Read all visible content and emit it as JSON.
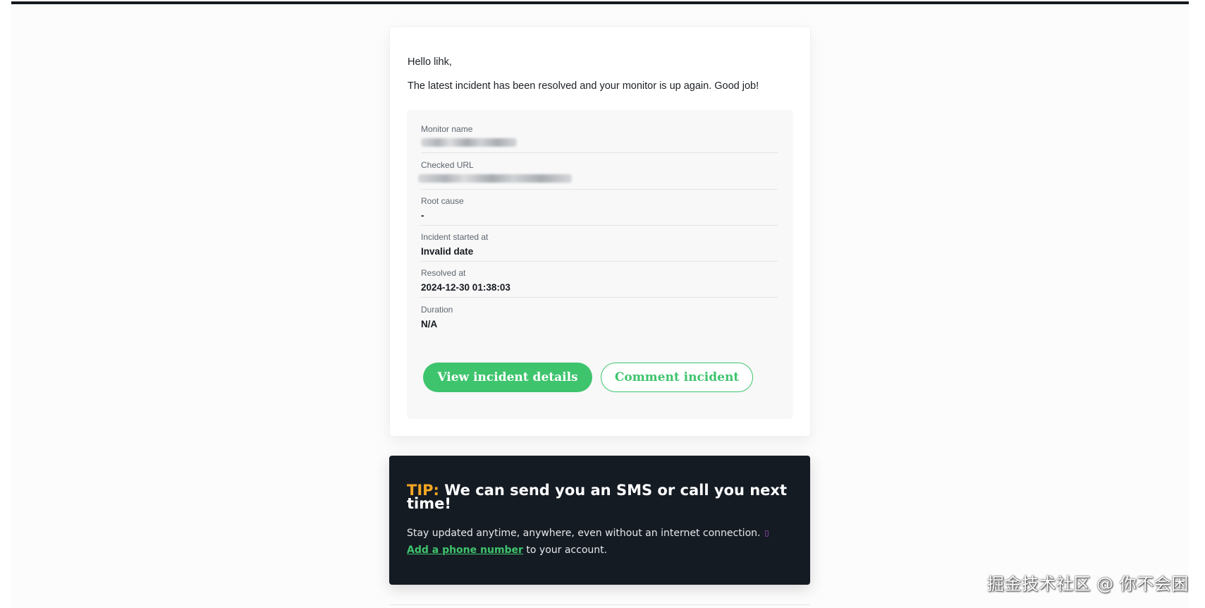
{
  "email": {
    "greeting": "Hello lihk,",
    "message": "The latest incident has been resolved and your monitor is up again. Good job!"
  },
  "details": {
    "monitor_name_label": "Monitor name",
    "checked_url_label": "Checked URL",
    "root_cause_label": "Root cause",
    "root_cause_value": "-",
    "incident_started_label": "Incident started at",
    "incident_started_value": "Invalid date",
    "resolved_label": "Resolved at",
    "resolved_value": "2024-12-30 01:38:03",
    "duration_label": "Duration",
    "duration_value": "N/A"
  },
  "buttons": {
    "view_details": "View incident details",
    "comment": "Comment incident"
  },
  "tip": {
    "label": "TIP:",
    "heading": " We can send you an SMS or call you next time!",
    "body": "Stay updated anytime, anywhere, even without an internet connection.",
    "link_text": "Add a phone number",
    "suffix": " to your account."
  },
  "watermark": "掘金技术社区 @ 你不会困",
  "colors": {
    "accent_green": "#3ec46d",
    "tip_orange": "#f5a623",
    "tip_background": "#151b23"
  },
  "icons": {
    "phone": "mobile-phone-icon"
  }
}
